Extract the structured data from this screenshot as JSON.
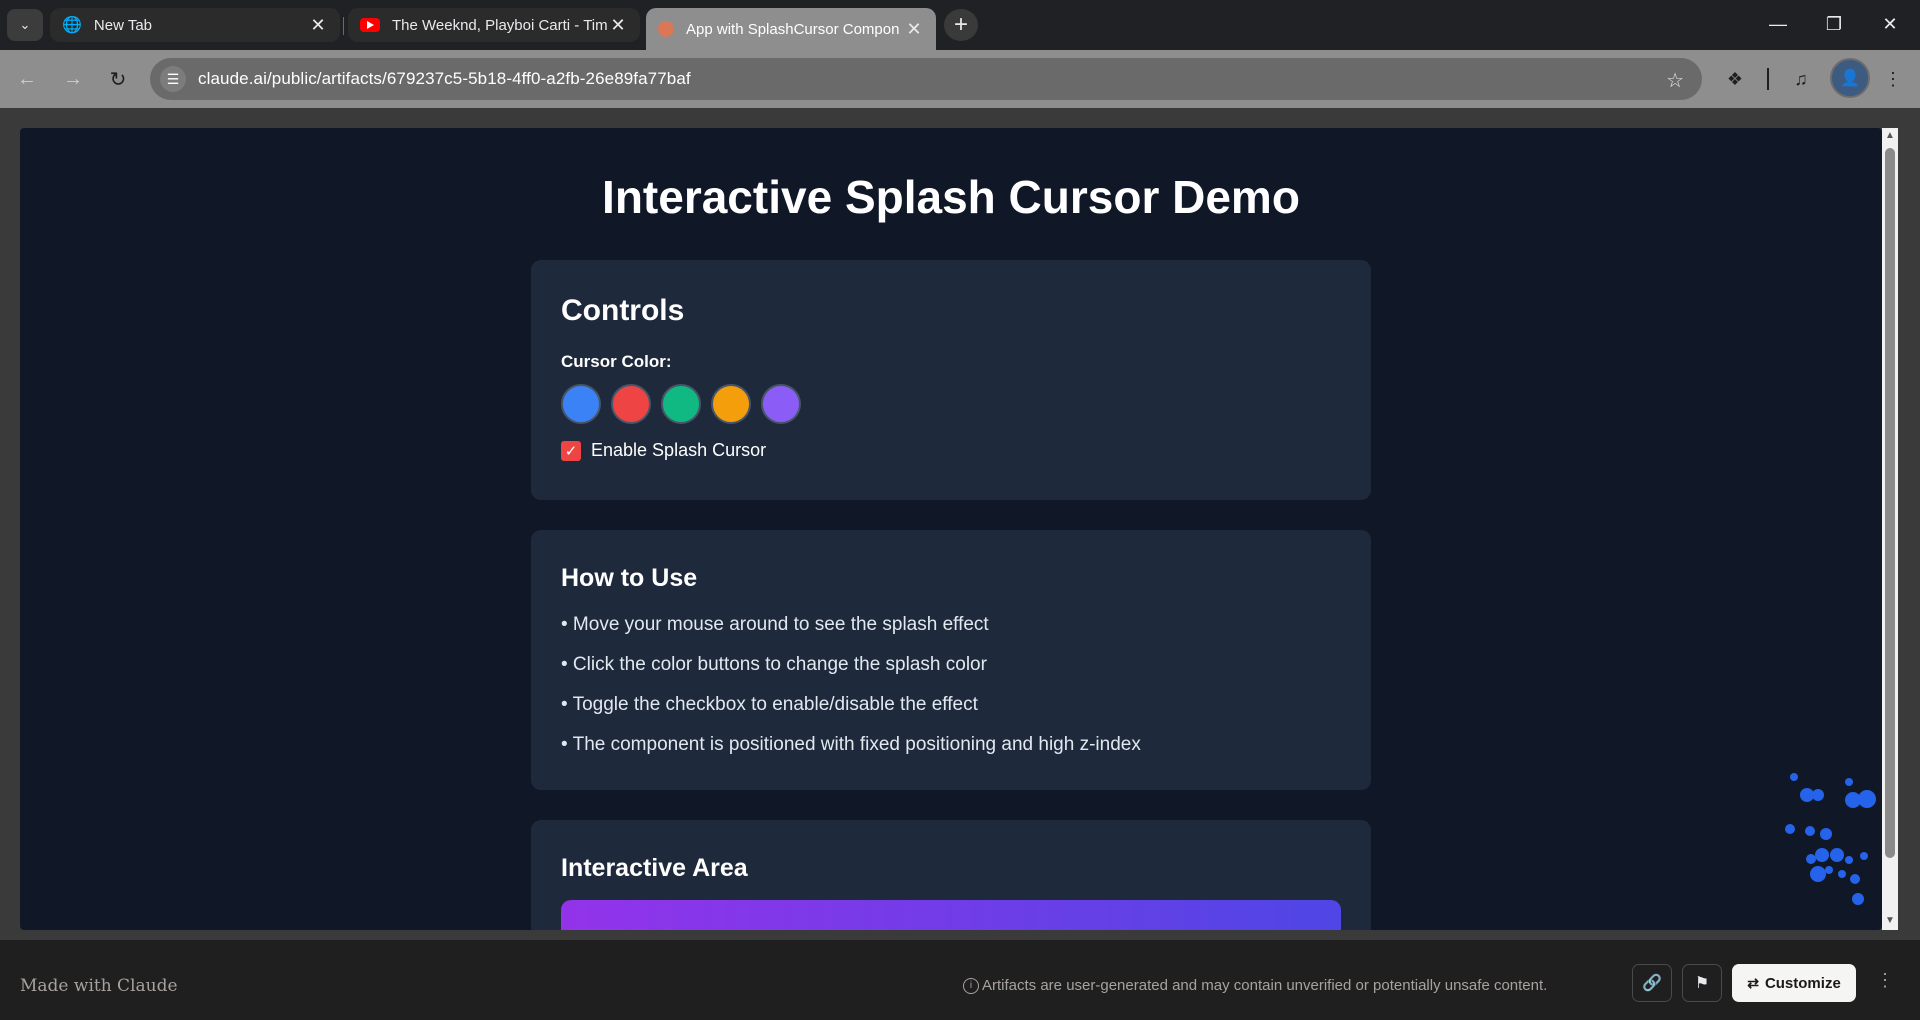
{
  "tabs": [
    {
      "title": "New Tab",
      "icon": "globe-icon",
      "active": false
    },
    {
      "title": "The Weeknd, Playboi Carti - Tim",
      "icon": "youtube-icon",
      "active": false
    },
    {
      "title": "App with SplashCursor Compon",
      "icon": "claude-icon",
      "active": true
    }
  ],
  "address_bar": {
    "url": "claude.ai/public/artifacts/679237c5-5b18-4ff0-a2fb-26e89fa77baf"
  },
  "page": {
    "title": "Interactive Splash Cursor Demo",
    "controls": {
      "heading": "Controls",
      "color_label": "Cursor Color:",
      "colors": [
        "#3b82f6",
        "#ef4444",
        "#10b981",
        "#f59e0b",
        "#8b5cf6"
      ],
      "toggle_label": "Enable Splash Cursor",
      "toggle_checked": true
    },
    "how_to_use": {
      "heading": "How to Use",
      "tips": [
        "• Move your mouse around to see the splash effect",
        "• Click the color buttons to change the splash color",
        "• Toggle the checkbox to enable/disable the effect",
        "• The component is positioned with fixed positioning and high z-index"
      ]
    },
    "interactive_area": {
      "heading": "Interactive Area"
    }
  },
  "footer": {
    "made_with": "Made with Claude",
    "notice": "Artifacts are user-generated and may contain unverified or potentially unsafe content.",
    "customize_label": "Customize"
  },
  "colors": {
    "page_bg": "#101828",
    "card_bg": "#1e293b",
    "splash": "#2563eb",
    "checkbox": "#ef4444"
  }
}
